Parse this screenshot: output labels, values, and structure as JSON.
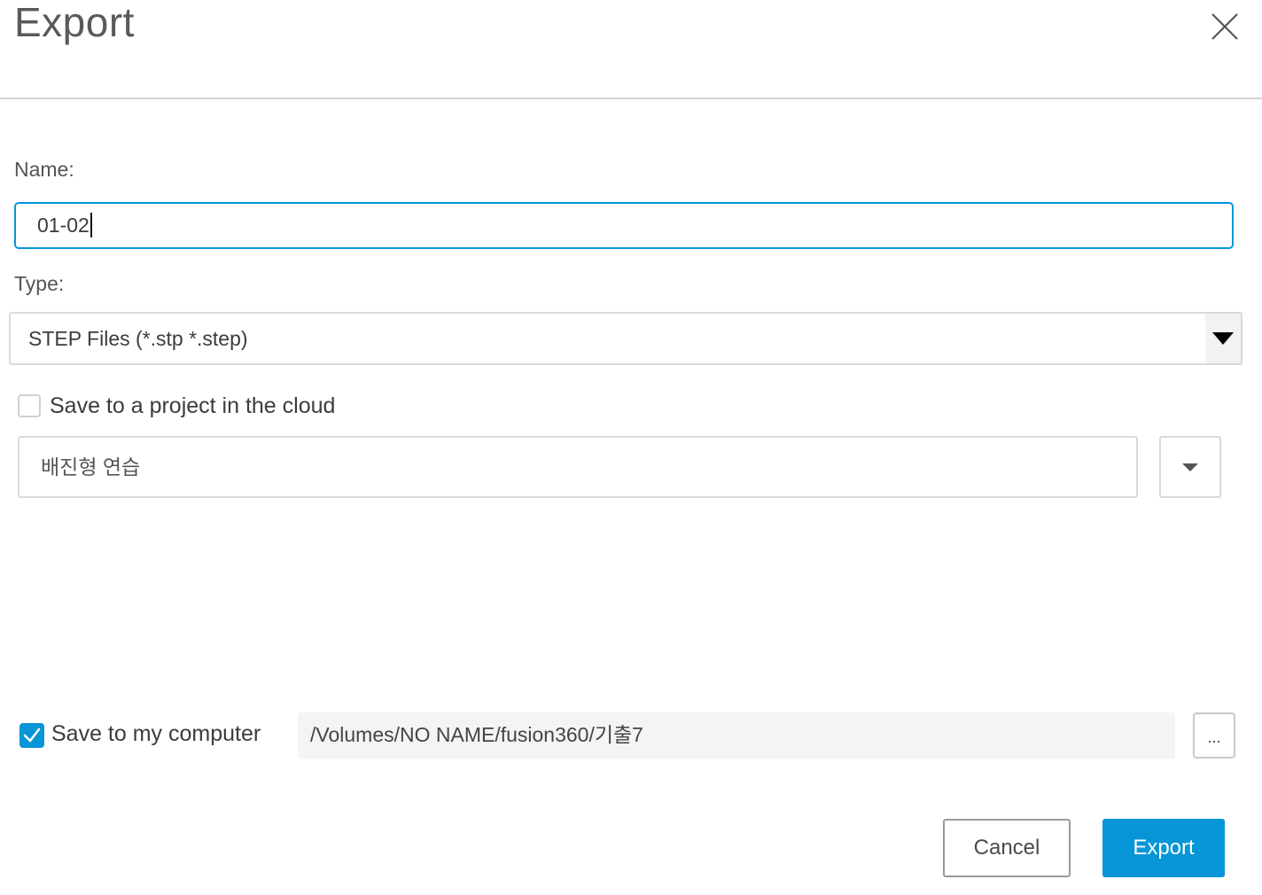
{
  "dialog": {
    "title": "Export"
  },
  "name": {
    "label": "Name:",
    "value": "01-02"
  },
  "type": {
    "label": "Type:",
    "selected": "STEP Files (*.stp *.step)"
  },
  "cloud": {
    "checked": false,
    "label": "Save to a project in the cloud",
    "project": "배진형 연습"
  },
  "computer": {
    "checked": true,
    "label": "Save to my computer",
    "path": "/Volumes/NO NAME/fusion360/기출7",
    "browse_label": "..."
  },
  "buttons": {
    "cancel": "Cancel",
    "export": "Export"
  },
  "colors": {
    "accent": "#0696d7",
    "border": "#d9d9d9",
    "field_bg": "#f3f4f6"
  },
  "icons": {
    "close": "close-icon",
    "dropdown": "chevron-down-icon",
    "check": "checkmark-icon"
  }
}
